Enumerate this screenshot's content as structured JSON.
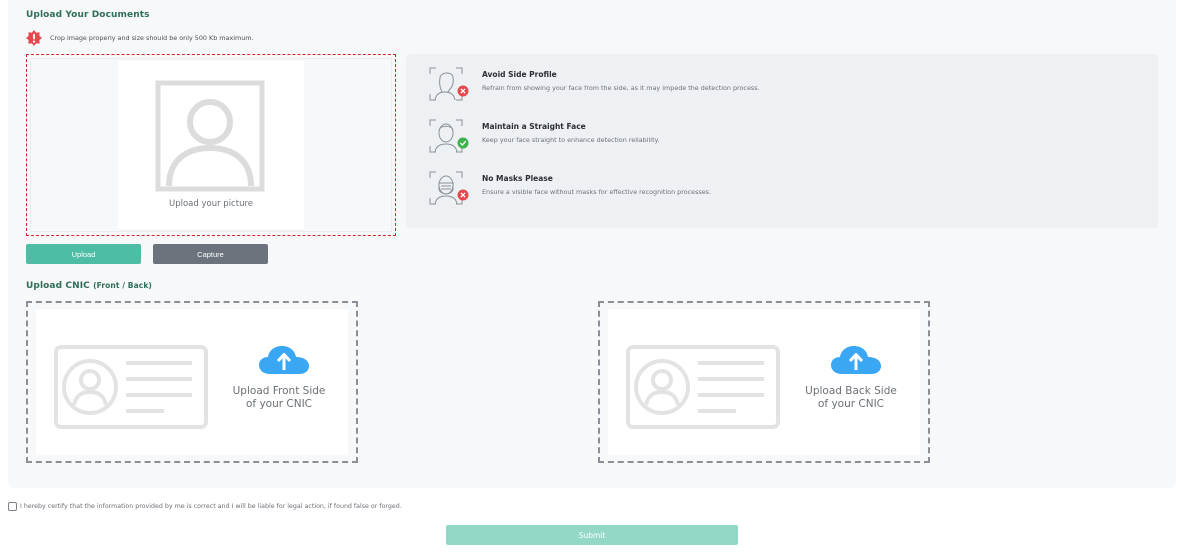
{
  "documents": {
    "title": "Upload Your Documents",
    "warning": "Crop image properly and size should be only 500 Kb maximum."
  },
  "photo": {
    "placeholder_label": "Upload your picture",
    "upload_label": "Upload",
    "capture_label": "Capture"
  },
  "guidelines": [
    {
      "title": "Avoid Side Profile",
      "desc": "Refrain from showing your face from the side, as it may impede the detection process.",
      "status": "bad"
    },
    {
      "title": "Maintain a Straight Face",
      "desc": "Keep your face straight to enhance detection reliability.",
      "status": "good"
    },
    {
      "title": "No Masks Please",
      "desc": "Ensure a visible face without masks for effective recognition processes.",
      "status": "bad"
    }
  ],
  "cnic": {
    "title": "Upload CNIC",
    "subtitle": "(Front / Back)",
    "front_line1": "Upload Front Side",
    "front_line2": "of your CNIC",
    "back_line1": "Upload Back Side",
    "back_line2": "of your CNIC"
  },
  "certify": {
    "text": "I hereby certify that the information provided by me is correct and I will be liable for legal action, if found false or forged.",
    "checked": false
  },
  "submit_label": "Submit",
  "colors": {
    "accent": "#4dbda6",
    "heading": "#2f6e57",
    "error": "#e5484d",
    "success": "#3fb14d",
    "submit_disabled": "#93d8c6"
  }
}
